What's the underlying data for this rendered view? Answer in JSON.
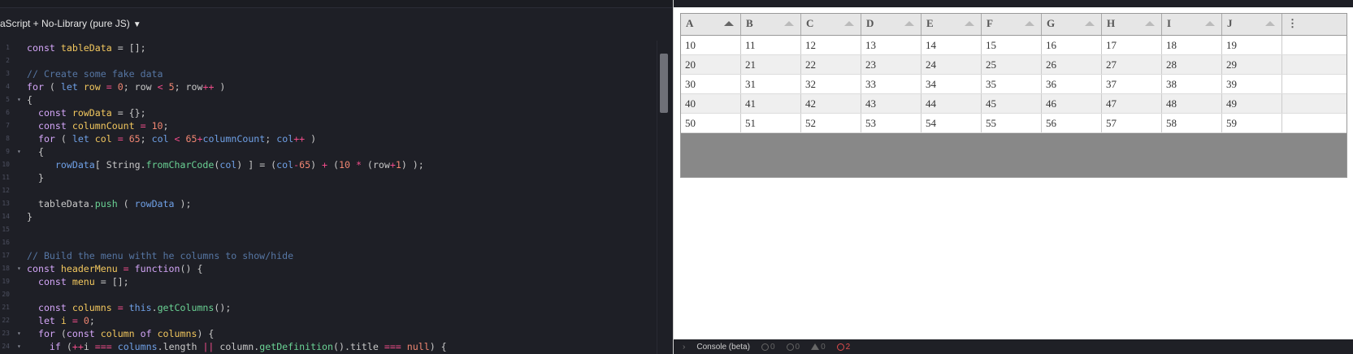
{
  "editor": {
    "language_label": "aScript + No-Library (pure JS)",
    "lines": [
      {
        "n": "1",
        "fold": "",
        "tokens": [
          [
            "k",
            "const "
          ],
          [
            "v",
            "tableData"
          ],
          [
            "p",
            " = [];"
          ]
        ]
      },
      {
        "n": "2",
        "fold": "",
        "tokens": []
      },
      {
        "n": "3",
        "fold": "",
        "tokens": [
          [
            "c",
            "// Create some fake data"
          ]
        ]
      },
      {
        "n": "4",
        "fold": "",
        "tokens": [
          [
            "k",
            "for"
          ],
          [
            "p",
            " ( "
          ],
          [
            "kb",
            "let "
          ],
          [
            "v",
            "row"
          ],
          [
            "o",
            " = "
          ],
          [
            "n",
            "0"
          ],
          [
            "p",
            "; row "
          ],
          [
            "o",
            "<"
          ],
          [
            "p",
            " "
          ],
          [
            "n",
            "5"
          ],
          [
            "p",
            "; row"
          ],
          [
            "o",
            "++"
          ],
          [
            "p",
            " )"
          ]
        ]
      },
      {
        "n": "5",
        "fold": "▾",
        "tokens": [
          [
            "p",
            "{"
          ]
        ]
      },
      {
        "n": "6",
        "fold": "",
        "tokens": [
          [
            "k",
            "  const "
          ],
          [
            "v",
            "rowData"
          ],
          [
            "p",
            " = {};"
          ]
        ]
      },
      {
        "n": "7",
        "fold": "",
        "tokens": [
          [
            "k",
            "  const "
          ],
          [
            "v",
            "columnCount"
          ],
          [
            "o",
            " = "
          ],
          [
            "n",
            "10"
          ],
          [
            "p",
            ";"
          ]
        ]
      },
      {
        "n": "8",
        "fold": "",
        "tokens": [
          [
            "k",
            "  for"
          ],
          [
            "p",
            " ( "
          ],
          [
            "kb",
            "let "
          ],
          [
            "v",
            "col"
          ],
          [
            "o",
            " = "
          ],
          [
            "n",
            "65"
          ],
          [
            "p",
            "; "
          ],
          [
            "kb",
            "col"
          ],
          [
            "o",
            " < "
          ],
          [
            "n",
            "65"
          ],
          [
            "o",
            "+"
          ],
          [
            "kb",
            "columnCount"
          ],
          [
            "p",
            "; "
          ],
          [
            "kb",
            "col"
          ],
          [
            "o",
            "++"
          ],
          [
            "p",
            " )"
          ]
        ]
      },
      {
        "n": "9",
        "fold": "▾",
        "tokens": [
          [
            "p",
            "  {"
          ]
        ]
      },
      {
        "n": "10",
        "fold": "",
        "tokens": [
          [
            "kb",
            "     rowData"
          ],
          [
            "p",
            "[ String."
          ],
          [
            "f",
            "fromCharCode"
          ],
          [
            "p",
            "("
          ],
          [
            "kb",
            "col"
          ],
          [
            "p",
            ") ] = ("
          ],
          [
            "kb",
            "col"
          ],
          [
            "o",
            "-"
          ],
          [
            "n",
            "65"
          ],
          [
            "p",
            ") "
          ],
          [
            "o",
            "+"
          ],
          [
            "p",
            " ("
          ],
          [
            "n",
            "10"
          ],
          [
            "o",
            " * "
          ],
          [
            "p",
            "(row"
          ],
          [
            "o",
            "+"
          ],
          [
            "n",
            "1"
          ],
          [
            "p",
            ") );"
          ]
        ]
      },
      {
        "n": "11",
        "fold": "",
        "tokens": [
          [
            "p",
            "  }"
          ]
        ]
      },
      {
        "n": "12",
        "fold": "",
        "tokens": []
      },
      {
        "n": "13",
        "fold": "",
        "tokens": [
          [
            "p",
            "  tableData."
          ],
          [
            "f",
            "push"
          ],
          [
            "p",
            " ( "
          ],
          [
            "kb",
            "rowData"
          ],
          [
            "p",
            " );"
          ]
        ]
      },
      {
        "n": "14",
        "fold": "",
        "tokens": [
          [
            "p",
            "}"
          ]
        ]
      },
      {
        "n": "15",
        "fold": "",
        "tokens": []
      },
      {
        "n": "16",
        "fold": "",
        "tokens": []
      },
      {
        "n": "17",
        "fold": "",
        "tokens": [
          [
            "c",
            "// Build the menu witht he columns to show/hide"
          ]
        ]
      },
      {
        "n": "18",
        "fold": "▾",
        "tokens": [
          [
            "k",
            "const "
          ],
          [
            "v",
            "headerMenu"
          ],
          [
            "o",
            " = "
          ],
          [
            "k",
            "function"
          ],
          [
            "p",
            "() {"
          ]
        ]
      },
      {
        "n": "19",
        "fold": "",
        "tokens": [
          [
            "k",
            "  const "
          ],
          [
            "v",
            "menu"
          ],
          [
            "p",
            " = [];"
          ]
        ]
      },
      {
        "n": "20",
        "fold": "",
        "tokens": []
      },
      {
        "n": "21",
        "fold": "",
        "tokens": [
          [
            "k",
            "  const "
          ],
          [
            "v",
            "columns"
          ],
          [
            "o",
            " = "
          ],
          [
            "kb",
            "this"
          ],
          [
            "p",
            "."
          ],
          [
            "f",
            "getColumns"
          ],
          [
            "p",
            "();"
          ]
        ]
      },
      {
        "n": "22",
        "fold": "",
        "tokens": [
          [
            "k",
            "  let "
          ],
          [
            "v",
            "i"
          ],
          [
            "o",
            " = "
          ],
          [
            "n",
            "0"
          ],
          [
            "p",
            ";"
          ]
        ]
      },
      {
        "n": "23",
        "fold": "▾",
        "tokens": [
          [
            "k",
            "  for"
          ],
          [
            "p",
            " ("
          ],
          [
            "k",
            "const "
          ],
          [
            "v",
            "column"
          ],
          [
            "k",
            " of "
          ],
          [
            "v",
            "columns"
          ],
          [
            "p",
            ") {"
          ]
        ]
      },
      {
        "n": "24",
        "fold": "▾",
        "tokens": [
          [
            "k",
            "    if"
          ],
          [
            "p",
            " ("
          ],
          [
            "o",
            "++"
          ],
          [
            "p",
            "i "
          ],
          [
            "o",
            "==="
          ],
          [
            "p",
            " "
          ],
          [
            "kb",
            "columns"
          ],
          [
            "p",
            ".length "
          ],
          [
            "o",
            "||"
          ],
          [
            "p",
            " column."
          ],
          [
            "f",
            "getDefinition"
          ],
          [
            "p",
            "().title "
          ],
          [
            "o",
            "==="
          ],
          [
            "p",
            " "
          ],
          [
            "n",
            "null"
          ],
          [
            "p",
            ") {"
          ]
        ]
      }
    ]
  },
  "table": {
    "headers": [
      "A",
      "B",
      "C",
      "D",
      "E",
      "F",
      "G",
      "H",
      "I",
      "J"
    ],
    "sorted_column": 0,
    "menu_glyph": "⋮",
    "rows": [
      [
        10,
        11,
        12,
        13,
        14,
        15,
        16,
        17,
        18,
        19
      ],
      [
        20,
        21,
        22,
        23,
        24,
        25,
        26,
        27,
        28,
        29
      ],
      [
        30,
        31,
        32,
        33,
        34,
        35,
        36,
        37,
        38,
        39
      ],
      [
        40,
        41,
        42,
        43,
        44,
        45,
        46,
        47,
        48,
        49
      ],
      [
        50,
        51,
        52,
        53,
        54,
        55,
        56,
        57,
        58,
        59
      ]
    ]
  },
  "console": {
    "title": "Console (beta)",
    "counts": [
      {
        "icon": "info-icon",
        "value": "0"
      },
      {
        "icon": "info-icon",
        "value": "0"
      },
      {
        "icon": "warning-icon",
        "value": "0"
      },
      {
        "icon": "error-icon",
        "value": "2"
      }
    ]
  }
}
